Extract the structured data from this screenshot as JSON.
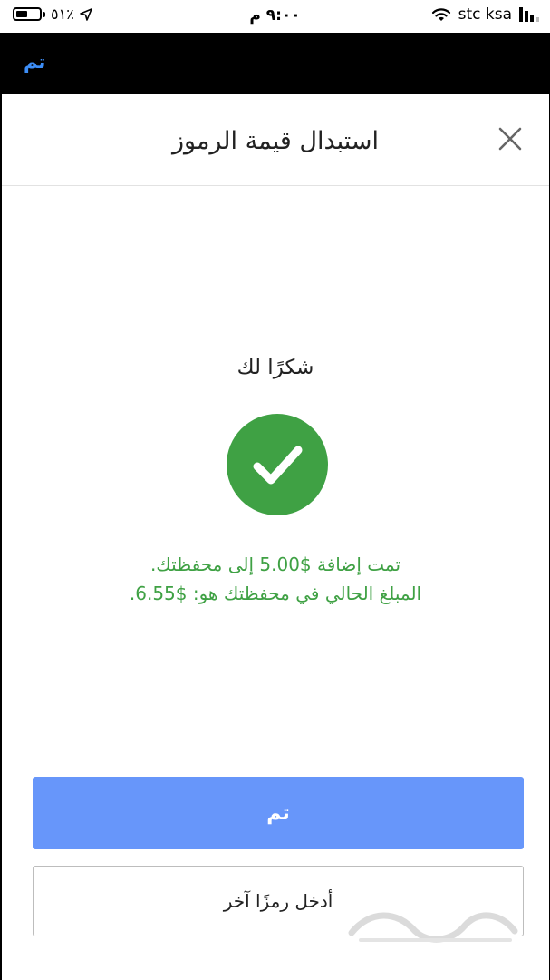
{
  "status_bar": {
    "battery_percent": "٥١٪",
    "battery_level": 0.51,
    "time": "٩:٠٠ م",
    "carrier": "stc ksa",
    "icons": [
      "battery-icon",
      "location-arrow-icon",
      "wifi-icon",
      "signal-bars-icon"
    ]
  },
  "navbar": {
    "done_label": "تم"
  },
  "sheet": {
    "title": "استبدال قيمة الرموز",
    "close_icon": "close-icon",
    "thanks": "شكرًا لك",
    "success_icon": "check-icon",
    "message_line1": "تمت إضافة $5.00 إلى محفظتك.",
    "message_line2": "المبلغ الحالي في محفظتك هو: $6.55.",
    "done_button": "تم",
    "enter_another_button": "أدخل رمزًا آخر"
  },
  "colors": {
    "accent_blue": "#6796fa",
    "success_green": "#3fa144",
    "nav_link": "#3d8ef7"
  },
  "watermark_icon": "haraj-logo"
}
